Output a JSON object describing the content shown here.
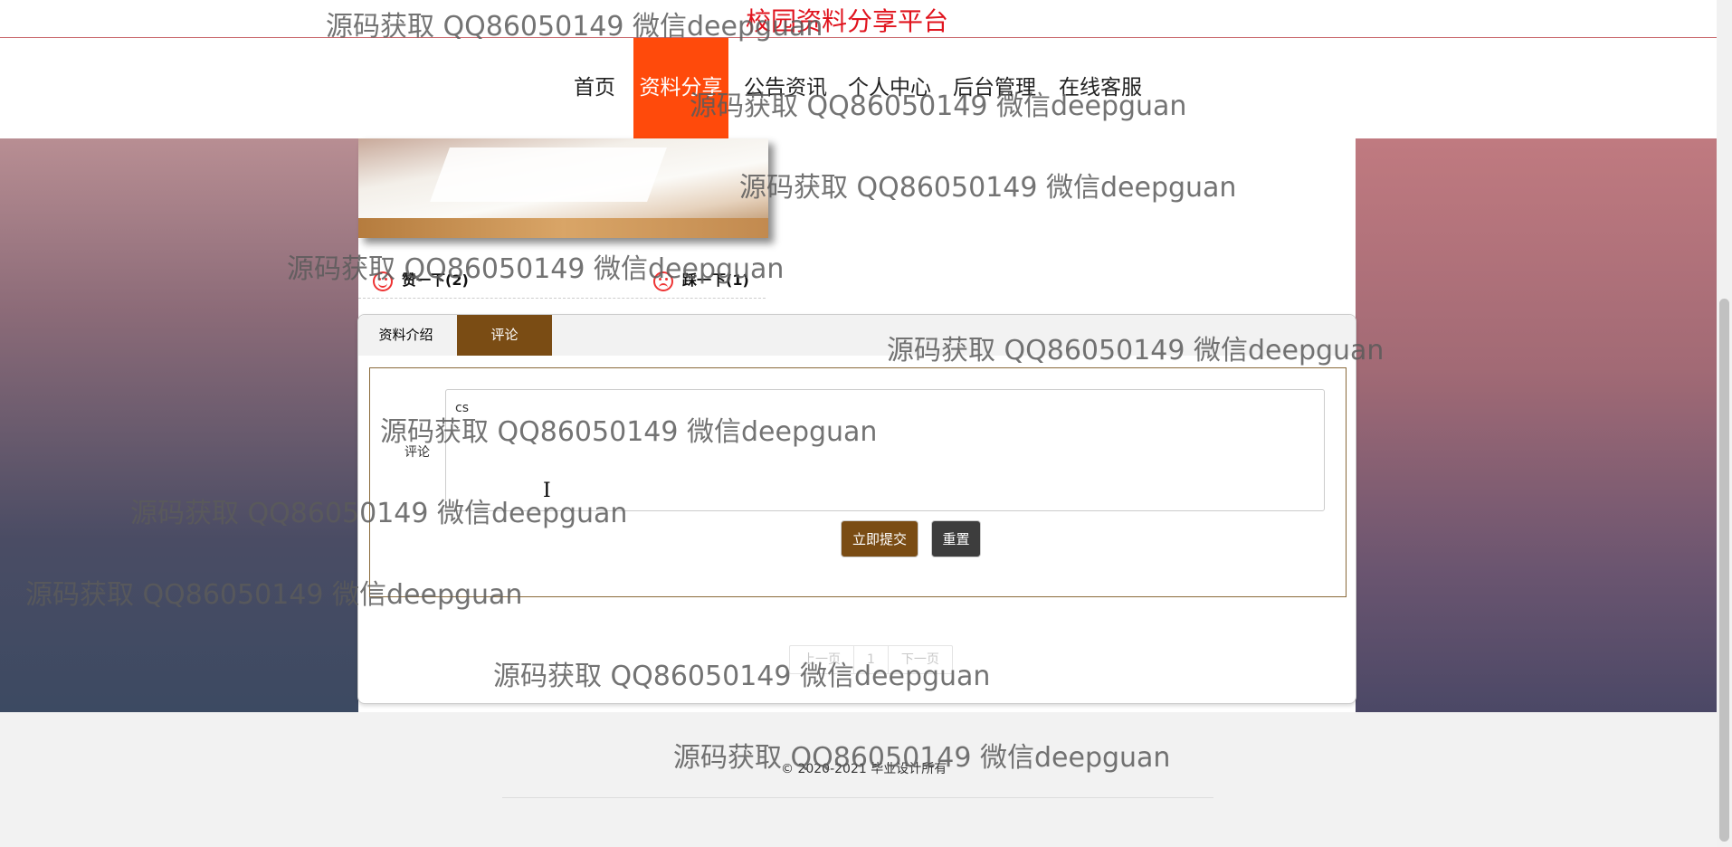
{
  "header": {
    "site_title": "校园资料分享平台"
  },
  "nav": {
    "items": [
      "首页",
      "资料分享",
      "公告资讯",
      "个人中心",
      "后台管理",
      "在线客服"
    ],
    "active": "资料分享"
  },
  "votes": {
    "like_label": "赞一下(2)",
    "dislike_label": "踩一下(1)",
    "like_icon": "smile-icon",
    "dislike_icon": "frown-icon"
  },
  "tabs": {
    "intro": "资料介绍",
    "comment": "评论",
    "active": "评论"
  },
  "comment_form": {
    "label": "评论",
    "value": "cs",
    "submit_label": "立即提交",
    "reset_label": "重置"
  },
  "pager": {
    "prev": "上一页",
    "page": "1",
    "next": "下一页"
  },
  "footer": {
    "copyright": "© 2020-2021 毕业设计所有"
  },
  "watermark": {
    "text": "源码获取 QQ86050149 微信deepguan"
  },
  "colors": {
    "nav_active": "#ff4a0b",
    "title_red": "#e0141e",
    "brown": "#7a4c14"
  }
}
